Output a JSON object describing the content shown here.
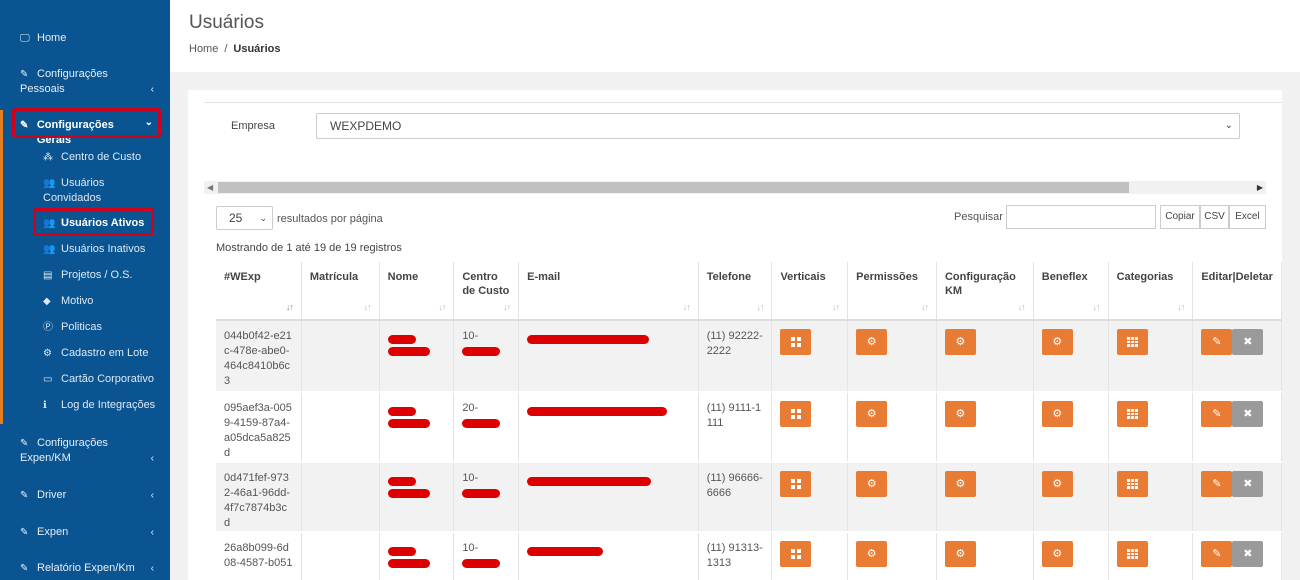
{
  "sidebar": {
    "items_top": [
      {
        "label": "Home",
        "icon": "laptop-icon",
        "chevron": ""
      },
      {
        "label": "Configurações Pessoais",
        "icon": "edit-icon",
        "chevron": "‹"
      },
      {
        "label": "Configurações Gerais",
        "icon": "edit-icon",
        "chevron": "⌄"
      }
    ],
    "sub_items": [
      {
        "label": "Centro de Custo",
        "icon": "cubes-icon"
      },
      {
        "label": "Usuários Convidados",
        "icon": "users-icon"
      },
      {
        "label": "Usuários Ativos",
        "icon": "users-icon"
      },
      {
        "label": "Usuários Inativos",
        "icon": "users-icon"
      },
      {
        "label": "Projetos / O.S.",
        "icon": "list-icon"
      },
      {
        "label": "Motivo",
        "icon": "tag-icon"
      },
      {
        "label": "Politicas",
        "icon": "p-circle-icon"
      },
      {
        "label": "Cadastro em Lote",
        "icon": "cogs-icon"
      },
      {
        "label": "Cartão Corporativo",
        "icon": "card-icon"
      },
      {
        "label": "Log de Integrações",
        "icon": "info-icon"
      }
    ],
    "items_bottom": [
      {
        "label": "Configurações Expen/KM",
        "icon": "edit-icon",
        "chevron": "‹"
      },
      {
        "label": "Driver",
        "icon": "edit-icon",
        "chevron": "‹"
      },
      {
        "label": "Expen",
        "icon": "edit-icon",
        "chevron": "‹"
      },
      {
        "label": "Relatório Expen/Km",
        "icon": "edit-icon",
        "chevron": "‹"
      }
    ],
    "highlight_color": "#d0021b"
  },
  "header": {
    "title": "Usuários",
    "breadcrumb": {
      "home": "Home",
      "sep": "/",
      "current": "Usuários"
    }
  },
  "filters": {
    "empresa_label": "Empresa",
    "empresa_value": "WEXPDEMO",
    "page_length": "25",
    "page_length_label": "resultados por página",
    "search_label": "Pesquisar",
    "search_value": "",
    "buttons": [
      "Copiar",
      "CSV",
      "Excel"
    ],
    "info": "Mostrando de 1 até 19 de 19 registros"
  },
  "table": {
    "columns": [
      "#WExp",
      "Matrícula",
      "Nome",
      "Centro de Custo",
      "E-mail",
      "Telefone",
      "Verticais",
      "Permissões",
      "Configuração KM",
      "Beneflex",
      "Categorias",
      "Editar|Deletar"
    ],
    "rows": [
      {
        "wexp": "044b0f42-e21c-478e-abe0-464c8410b6c3",
        "matricula": "",
        "nome": "[redacted]",
        "centro": "10-[redacted]",
        "email": "[redacted]",
        "telefone": "(11) 92222-2222"
      },
      {
        "wexp": "095aef3a-0059-4159-87a4-a05dca5a825d",
        "matricula": "",
        "nome": "[redacted]",
        "centro": "20-[redacted]",
        "email": "[redacted]",
        "telefone": "(11) 9111-1111"
      },
      {
        "wexp": "0d471fef-9732-46a1-96dd-4f7c7874b3cd",
        "matricula": "",
        "nome": "[redacted]",
        "centro": "10-[redacted]",
        "email": "[redacted]",
        "telefone": "(11) 96666-6666"
      },
      {
        "wexp": "26a8b099-6d08-4587-b051",
        "matricula": "",
        "nome": "[redacted]",
        "centro": "10-[redacted]",
        "email": "[redacted]",
        "telefone": "(11) 91313-1313"
      }
    ],
    "action_color": "#e87c35",
    "delete_color": "#9a9a9a",
    "redaction_color": "#dd0000"
  },
  "colors": {
    "sidebar_bg": "#0a5591",
    "accent": "#e67e22",
    "page_bg": "#f1f1f1"
  }
}
